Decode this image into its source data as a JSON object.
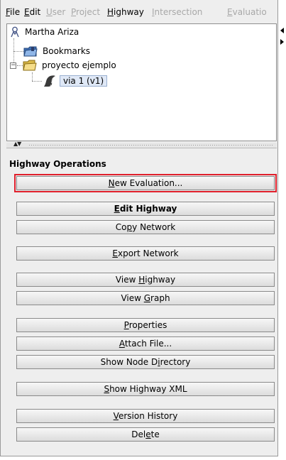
{
  "menubar": {
    "items": [
      {
        "before": "",
        "mnemonic": "F",
        "after": "ile",
        "enabled": true
      },
      {
        "before": "",
        "mnemonic": "E",
        "after": "dit",
        "enabled": true
      },
      {
        "before": "",
        "mnemonic": "U",
        "after": "ser",
        "enabled": false
      },
      {
        "before": "",
        "mnemonic": "P",
        "after": "roject",
        "enabled": false
      },
      {
        "before": "",
        "mnemonic": "H",
        "after": "ighway",
        "enabled": true
      },
      {
        "before": "",
        "mnemonic": "I",
        "after": "ntersection",
        "enabled": false
      },
      {
        "before": "",
        "mnemonic": "E",
        "after": "valuatio",
        "enabled": false
      }
    ]
  },
  "tree": {
    "user": "Martha Ariza",
    "bookmarks": "Bookmarks",
    "project": "proyecto ejemplo",
    "highway": "via 1 (v1)",
    "expander_symbol": "−"
  },
  "splitter": {
    "arrows": "▲▼"
  },
  "operations": {
    "title": "Highway Operations",
    "buttons": [
      {
        "before": "",
        "mnemonic": "N",
        "after": "ew Evaluation...",
        "bold": false,
        "highlighted": true
      },
      {
        "before": "",
        "mnemonic": "E",
        "after": "dit Highway",
        "bold": true,
        "highlighted": false
      },
      {
        "before": "Co",
        "mnemonic": "p",
        "after": "y Network",
        "bold": false,
        "highlighted": false
      },
      {
        "before": "",
        "mnemonic": "E",
        "after": "xport Network",
        "bold": false,
        "highlighted": false
      },
      {
        "before": "View ",
        "mnemonic": "H",
        "after": "ighway",
        "bold": false,
        "highlighted": false
      },
      {
        "before": "View ",
        "mnemonic": "G",
        "after": "raph",
        "bold": false,
        "highlighted": false
      },
      {
        "before": "",
        "mnemonic": "P",
        "after": "roperties",
        "bold": false,
        "highlighted": false
      },
      {
        "before": "",
        "mnemonic": "A",
        "after": "ttach File...",
        "bold": false,
        "highlighted": false
      },
      {
        "before": "Show Node D",
        "mnemonic": "i",
        "after": "rectory",
        "bold": false,
        "highlighted": false
      },
      {
        "before": "",
        "mnemonic": "S",
        "after": "how Highway XML",
        "bold": false,
        "highlighted": false
      },
      {
        "before": "",
        "mnemonic": "V",
        "after": "ersion History",
        "bold": false,
        "highlighted": false
      },
      {
        "before": "Del",
        "mnemonic": "e",
        "after": "te",
        "bold": false,
        "highlighted": false
      }
    ]
  },
  "colors": {
    "highlight_border": "#e0202c",
    "selection_bg": "#dfe8f6"
  },
  "icons": [
    "user-icon",
    "bookmarks-folder-icon",
    "project-folder-icon",
    "highway-icon",
    "collapse-icon",
    "split-arrows-icon"
  ]
}
